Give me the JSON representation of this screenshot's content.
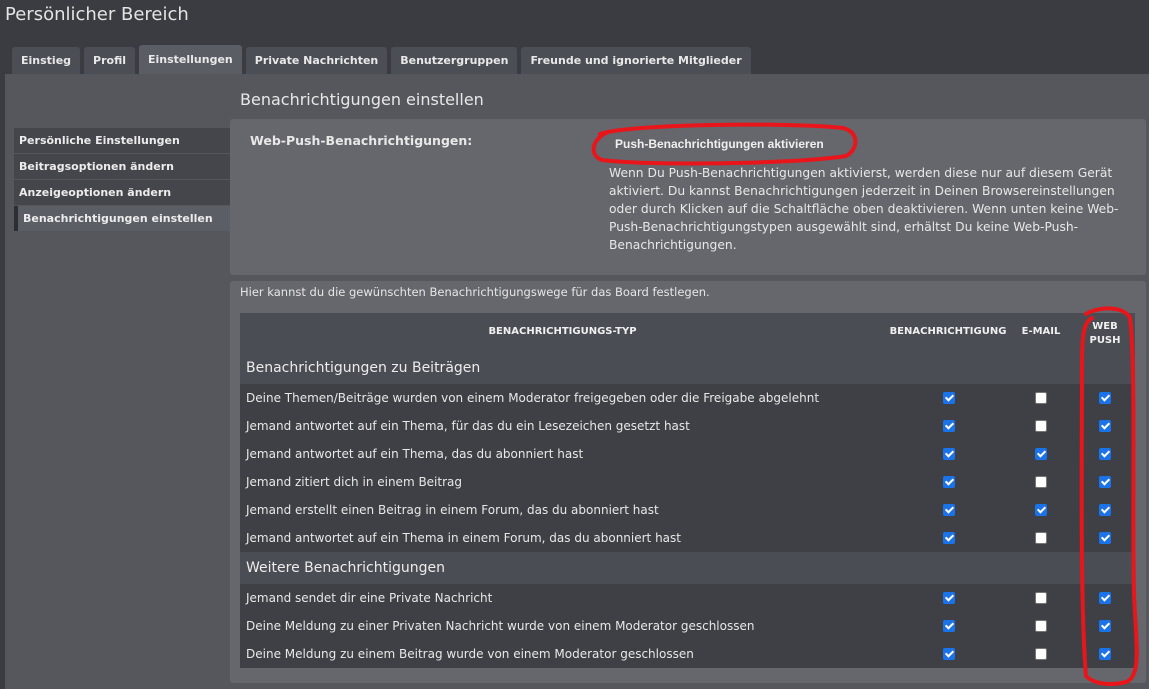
{
  "page": {
    "title": "Persönlicher Bereich"
  },
  "tabs": [
    {
      "label": "Einstieg"
    },
    {
      "label": "Profil"
    },
    {
      "label": "Einstellungen"
    },
    {
      "label": "Private Nachrichten"
    },
    {
      "label": "Benutzergruppen"
    },
    {
      "label": "Freunde und ignorierte Mitglieder"
    }
  ],
  "active_tab": "Einstellungen",
  "sidebar": {
    "items": [
      {
        "label": "Persönliche Einstellungen"
      },
      {
        "label": "Beitragsoptionen ändern"
      },
      {
        "label": "Anzeigeoptionen ändern"
      },
      {
        "label": "Benachrichtigungen einstellen"
      }
    ],
    "active_item": "Benachrichtigungen einstellen"
  },
  "main": {
    "section_title": "Benachrichtigungen einstellen",
    "web_push": {
      "label": "Web-Push-Benachrichtigungen:",
      "button_label": "Push-Benachrichtigungen aktivieren",
      "description": "Wenn Du Push-Benachrichtigungen aktivierst, werden diese nur auf diesem Gerät aktiviert. Du kannst Benachrichtigungen jederzeit in Deinen Browsereinstellungen oder durch Klicken auf die Schaltfläche oben deaktivieren. Wenn unten keine Web-Push-Benachrichtigungstypen ausgewählt sind, erhältst Du keine Web-Push-Benachrichtigungen."
    },
    "ways_intro": "Hier kannst du die gewünschten Benachrichtigungswege für das Board festlegen.",
    "table": {
      "headers": {
        "type": "BENACHRICHTIGUNGS-TYP",
        "notification": "BENACHRICHTIGUNG",
        "email": "E-MAIL",
        "webpush_line1": "WEB",
        "webpush_line2": "PUSH"
      },
      "groups": [
        {
          "title": "Benachrichtigungen zu Beiträgen",
          "rows": [
            {
              "label": "Deine Themen/Beiträge wurden von einem Moderator freigegeben oder die Freigabe abgelehnt",
              "notification": true,
              "email": false,
              "webpush": true
            },
            {
              "label": "Jemand antwortet auf ein Thema, für das du ein Lesezeichen gesetzt hast",
              "notification": true,
              "email": false,
              "webpush": true
            },
            {
              "label": "Jemand antwortet auf ein Thema, das du abonniert hast",
              "notification": true,
              "email": true,
              "webpush": true
            },
            {
              "label": "Jemand zitiert dich in einem Beitrag",
              "notification": true,
              "email": false,
              "webpush": true
            },
            {
              "label": "Jemand erstellt einen Beitrag in einem Forum, das du abonniert hast",
              "notification": true,
              "email": true,
              "webpush": true
            },
            {
              "label": "Jemand antwortet auf ein Thema in einem Forum, das du abonniert hast",
              "notification": true,
              "email": false,
              "webpush": true
            }
          ]
        },
        {
          "title": "Weitere Benachrichtigungen",
          "rows": [
            {
              "label": "Jemand sendet dir eine Private Nachricht",
              "notification": true,
              "email": false,
              "webpush": true
            },
            {
              "label": "Deine Meldung zu einer Privaten Nachricht wurde von einem Moderator geschlossen",
              "notification": true,
              "email": false,
              "webpush": true
            },
            {
              "label": "Deine Meldung zu einem Beitrag wurde von einem Moderator geschlossen",
              "notification": true,
              "email": false,
              "webpush": true
            }
          ]
        }
      ]
    }
  },
  "colors": {
    "annotation": "#e8151b",
    "checkbox_checked": "#1a73e8"
  }
}
